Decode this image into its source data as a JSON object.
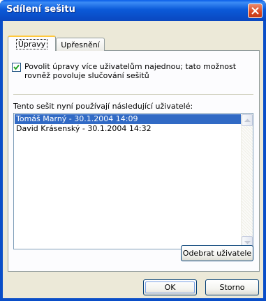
{
  "window": {
    "title": "Sdílení sešitu"
  },
  "tabs": [
    {
      "label": "Úpravy",
      "active": true
    },
    {
      "label": "Upřesnění",
      "active": false
    }
  ],
  "options": {
    "allow_multi_user": {
      "checked": true,
      "label_line1": "Povolit úpravy více uživatelům najednou; tato možnost",
      "label_line2": "rovněž povoluje slučování sešitů"
    }
  },
  "users": {
    "label": "Tento sešit nyní používají následující uživatelé:",
    "items": [
      {
        "text": "Tomáš Marný - 30.1.2004 14:09",
        "selected": true
      },
      {
        "text": "David Krásenský - 30.1.2004 14:32",
        "selected": false
      }
    ],
    "remove_button": "Odebrat uživatele"
  },
  "footer": {
    "ok_label": "OK",
    "cancel_label": "Storno"
  },
  "colors": {
    "titlebar": "#0a4ec8",
    "selection": "#316ac5",
    "dialog_bg": "#ece9d8"
  }
}
